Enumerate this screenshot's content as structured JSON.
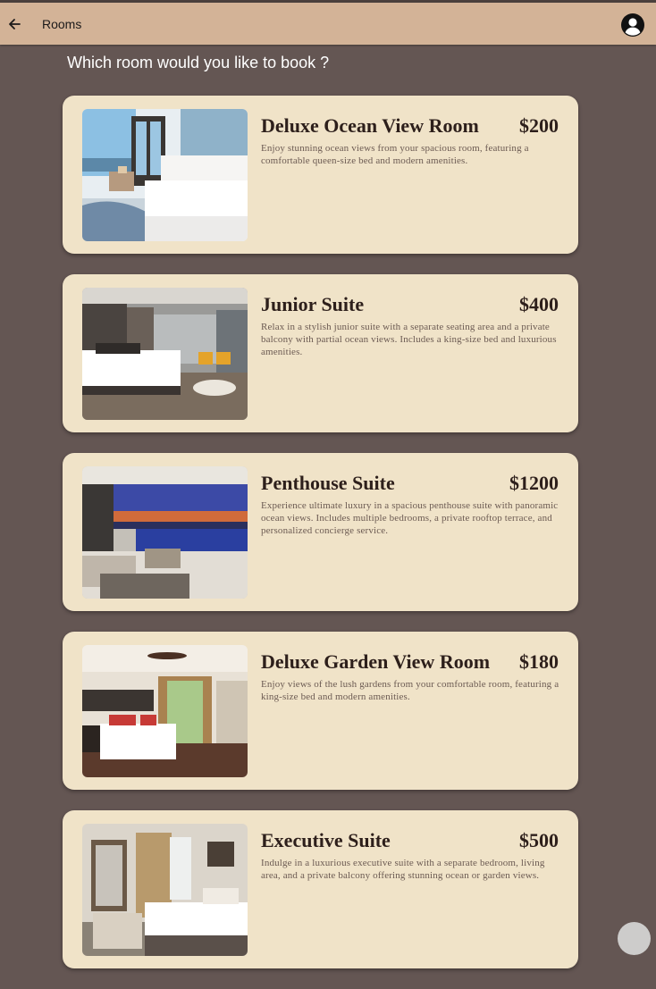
{
  "appbar": {
    "title": "Rooms"
  },
  "page": {
    "heading": "Which room would you like to book ?"
  },
  "rooms": [
    {
      "name": "Deluxe Ocean View Room",
      "price": "$200",
      "description": "Enjoy stunning ocean views from your spacious room, featuring a comfortable queen-size bed and modern amenities."
    },
    {
      "name": "Junior Suite",
      "price": "$400",
      "description": "Relax in a stylish junior suite with a separate seating area and a private balcony with partial ocean views. Includes a king-size bed and luxurious amenities."
    },
    {
      "name": "Penthouse Suite",
      "price": "$1200",
      "description": "Experience ultimate luxury in a spacious penthouse suite with panoramic ocean views. Includes multiple bedrooms, a private rooftop terrace, and personalized concierge service."
    },
    {
      "name": "Deluxe Garden View Room",
      "price": "$180",
      "description": "Enjoy views of the lush gardens from your comfortable room, featuring a king-size bed and modern amenities."
    },
    {
      "name": "Executive Suite",
      "price": "$500",
      "description": "Indulge in a luxurious executive suite with a separate bedroom, living area, and a private balcony offering stunning ocean or garden views."
    }
  ],
  "icons": {
    "back": "arrow-left-icon",
    "account": "account-circle-icon"
  },
  "colors": {
    "background": "#645653",
    "appbar": "#d3b397",
    "card": "#f0e3c8",
    "title_text": "#2d1f1b",
    "body_text": "#6b5a52",
    "fab": "#cdcccb"
  }
}
